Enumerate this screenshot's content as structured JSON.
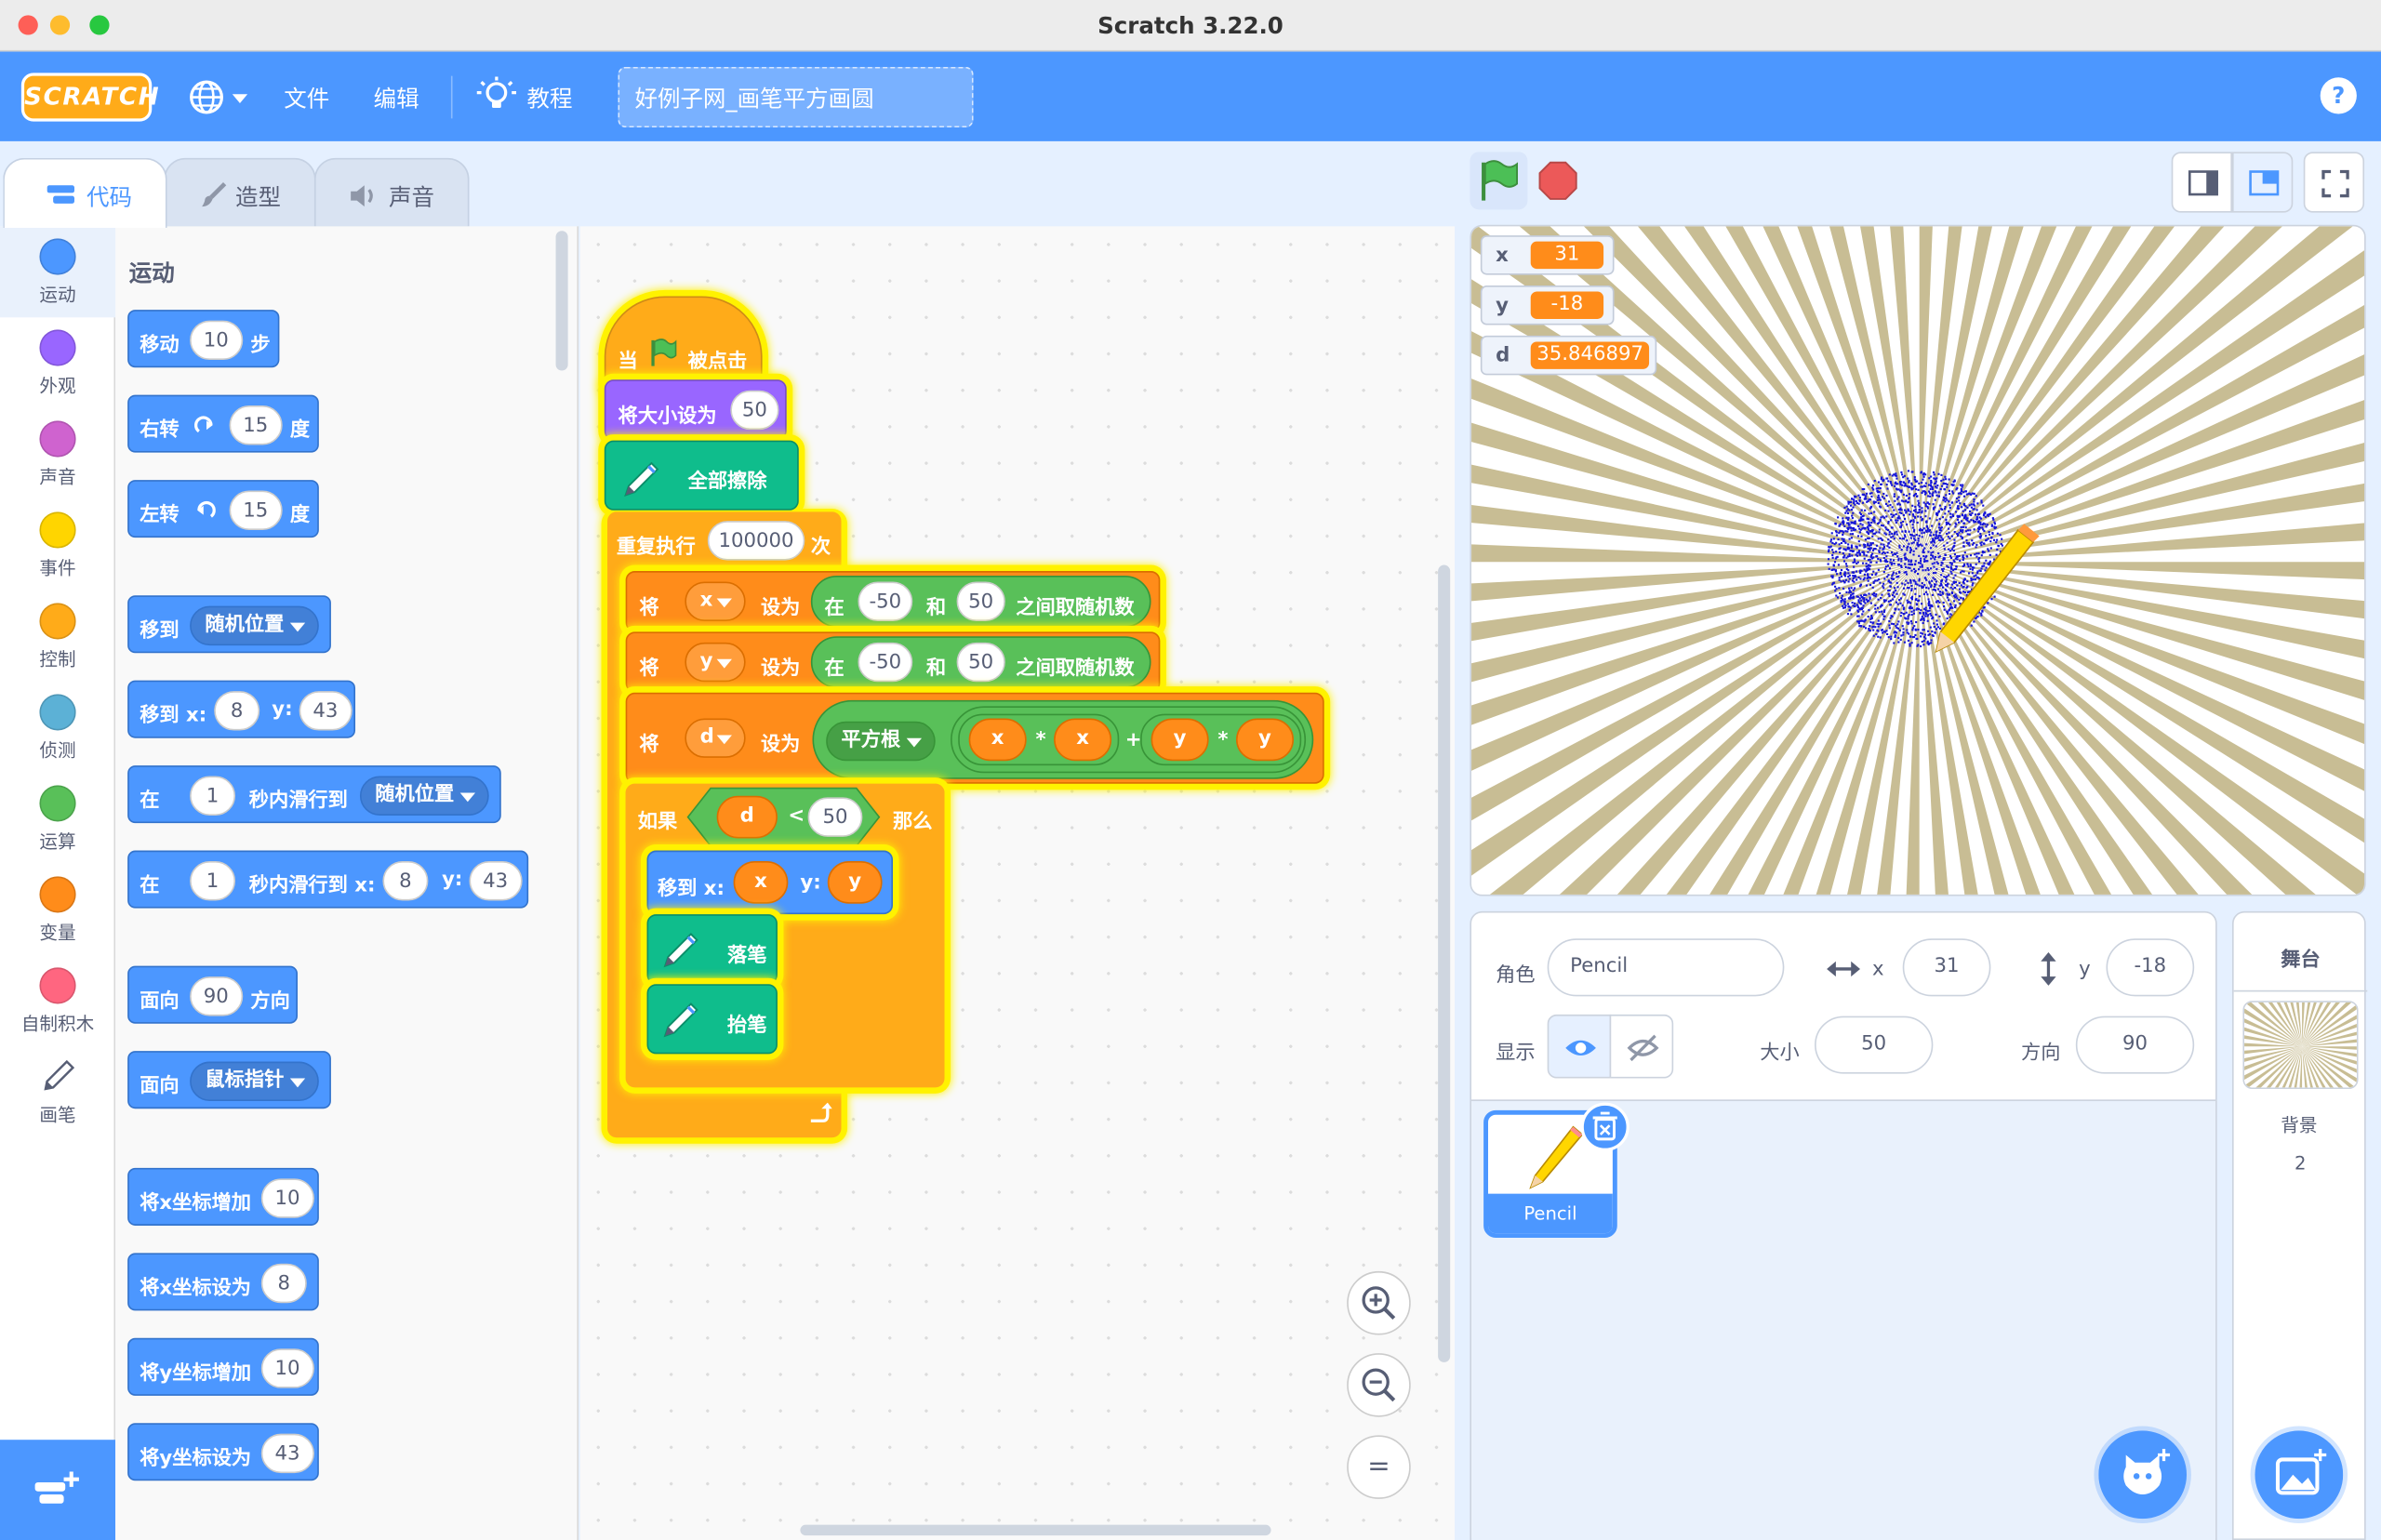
{
  "window": {
    "title": "Scratch 3.22.0"
  },
  "menubar": {
    "logo": "SCRATCH",
    "file": "文件",
    "edit": "编辑",
    "tutorials": "教程",
    "project_title": "好例子网_画笔平方画圆",
    "help": "?"
  },
  "tabs": {
    "code": "代码",
    "costumes": "造型",
    "sounds": "声音"
  },
  "categories": [
    {
      "label": "运动",
      "color": "#4c97ff"
    },
    {
      "label": "外观",
      "color": "#9966ff"
    },
    {
      "label": "声音",
      "color": "#cf63cf"
    },
    {
      "label": "事件",
      "color": "#ffd500"
    },
    {
      "label": "控制",
      "color": "#ffab19"
    },
    {
      "label": "侦测",
      "color": "#5cb1d6"
    },
    {
      "label": "运算",
      "color": "#59c059"
    },
    {
      "label": "变量",
      "color": "#ff8c1a"
    },
    {
      "label": "自制积木",
      "color": "#ff6680"
    },
    {
      "label": "画笔",
      "color": "#0fbd8c"
    }
  ],
  "palette": {
    "heading": "运动",
    "move": {
      "a": "移动",
      "v": "10",
      "b": "步"
    },
    "turn_right": {
      "a": "右转",
      "v": "15",
      "b": "度"
    },
    "turn_left": {
      "a": "左转",
      "v": "15",
      "b": "度"
    },
    "goto": {
      "a": "移到",
      "dd": "随机位置"
    },
    "goto_xy": {
      "a": "移到 x:",
      "x": "8",
      "yl": "y:",
      "y": "43"
    },
    "glide_to": {
      "a": "在",
      "v": "1",
      "b": "秒内滑行到",
      "dd": "随机位置"
    },
    "glide_xy": {
      "a": "在",
      "v": "1",
      "b": "秒内滑行到 x:",
      "x": "8",
      "yl": "y:",
      "y": "43"
    },
    "point_dir": {
      "a": "面向",
      "v": "90",
      "b": "方向"
    },
    "point_to": {
      "a": "面向",
      "dd": "鼠标指针"
    },
    "change_x": {
      "a": "将x坐标增加",
      "v": "10"
    },
    "set_x": {
      "a": "将x坐标设为",
      "v": "8"
    },
    "change_y": {
      "a": "将y坐标增加",
      "v": "10"
    },
    "set_y": {
      "a": "将y坐标设为",
      "v": "43"
    }
  },
  "script": {
    "hat": {
      "a": "当",
      "b": "被点击"
    },
    "set_size": {
      "a": "将大小设为",
      "v": "50"
    },
    "clear": "全部擦除",
    "repeat": {
      "a": "重复执行",
      "v": "100000",
      "b": "次"
    },
    "set_x": {
      "a": "将",
      "var": "x",
      "b": "设为",
      "c": "在",
      "lo": "-50",
      "and": "和",
      "hi": "50",
      "d": "之间取随机数"
    },
    "set_y": {
      "a": "将",
      "var": "y",
      "b": "设为",
      "c": "在",
      "lo": "-50",
      "and": "和",
      "hi": "50",
      "d": "之间取随机数"
    },
    "set_d": {
      "a": "将",
      "var": "d",
      "b": "设为",
      "fn": "平方根",
      "x1": "x",
      "mul1": "*",
      "x2": "x",
      "plus": "+",
      "y1": "y",
      "mul2": "*",
      "y2": "y"
    },
    "if": {
      "a": "如果",
      "var": "d",
      "op": "<",
      "v": "50",
      "b": "那么"
    },
    "goto": {
      "a": "移到 x:",
      "x": "x",
      "yl": "y:",
      "y": "y"
    },
    "pen_down": "落笔",
    "pen_up": "抬笔"
  },
  "zoom": {
    "in": "+",
    "out": "−",
    "reset": "="
  },
  "monitors": [
    {
      "name": "x",
      "value": "31"
    },
    {
      "name": "y",
      "value": "-18"
    },
    {
      "name": "d",
      "value": "35.846897"
    }
  ],
  "sprite_info": {
    "sprite_label": "角色",
    "sprite_name": "Pencil",
    "x_label": "x",
    "x": "31",
    "y_label": "y",
    "y": "-18",
    "show_label": "显示",
    "size_label": "大小",
    "size": "50",
    "direction_label": "方向",
    "direction": "90"
  },
  "sprites": [
    {
      "name": "Pencil"
    }
  ],
  "stage_panel": {
    "title": "舞台",
    "backdrops_label": "背景",
    "backdrops_count": "2"
  },
  "colors": {
    "accent": "#4c97ff",
    "control": "#ffab19",
    "variable": "#ff8c1a",
    "operator": "#59c059",
    "pen": "#0fbd8c",
    "looks": "#9966ff"
  }
}
